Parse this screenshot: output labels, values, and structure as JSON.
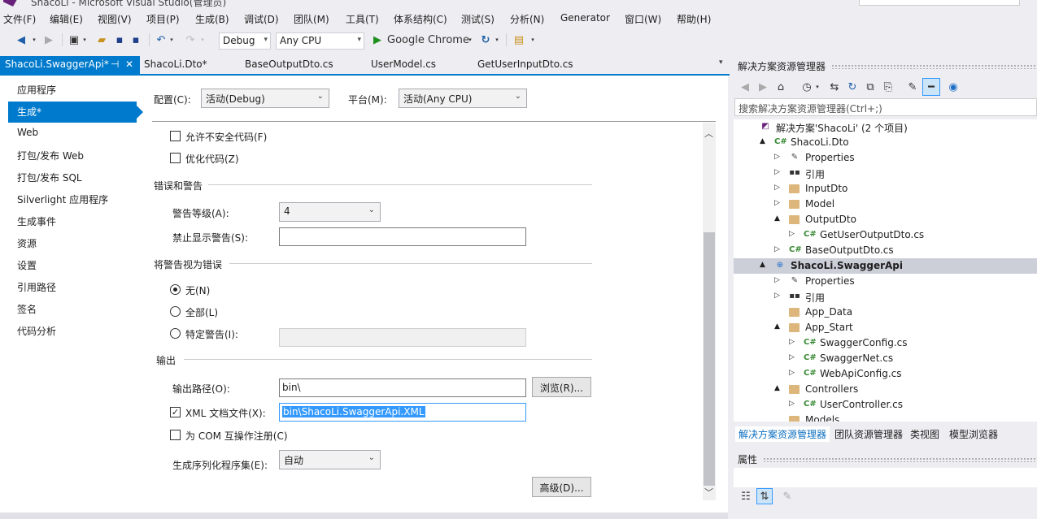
{
  "window": {
    "title": "ShacoLi - Microsoft Visual Studio(管理员)"
  },
  "menu": [
    "文件(F)",
    "编辑(E)",
    "视图(V)",
    "项目(P)",
    "生成(B)",
    "调试(D)",
    "团队(M)",
    "工具(T)",
    "体系结构(C)",
    "测试(S)",
    "分析(N)",
    "Generator",
    "窗口(W)",
    "帮助(H)"
  ],
  "toolbar": {
    "config": "Debug",
    "platform": "Any CPU",
    "run_target": "Google Chrome"
  },
  "tabs": [
    {
      "label": "ShacoLi.SwaggerApi*",
      "pin": "⊣",
      "close": "✕"
    },
    {
      "label": "ShacoLi.Dto*"
    },
    {
      "label": "BaseOutputDto.cs"
    },
    {
      "label": "UserModel.cs"
    },
    {
      "label": "GetUserInputDto.cs"
    }
  ],
  "nav": [
    "应用程序",
    "生成*",
    "Web",
    "打包/发布 Web",
    "打包/发布 SQL",
    "Silverlight 应用程序",
    "生成事件",
    "资源",
    "设置",
    "引用路径",
    "签名",
    "代码分析"
  ],
  "top": {
    "config_label": "配置(C):",
    "config_value": "活动(Debug)",
    "platform_label": "平台(M):",
    "platform_value": "活动(Any CPU)"
  },
  "opts": {
    "unsafe_label": "允许不安全代码(F)",
    "optimize_label": "优化代码(Z)"
  },
  "errors": {
    "section": "错误和警告",
    "warn_level_label": "警告等级(A):",
    "warn_level_value": "4",
    "suppress_label": "禁止显示警告(S):",
    "suppress_value": ""
  },
  "treat": {
    "section": "将警告视为错误",
    "none_label": "无(N)",
    "all_label": "全部(L)",
    "specific_label": "特定警告(I):",
    "selected": "none"
  },
  "output": {
    "section": "输出",
    "path_label": "输出路径(O):",
    "path_value": "bin\\",
    "browse_label": "浏览(R)...",
    "xml_label": "XML 文档文件(X):",
    "xml_checked": true,
    "xml_value": "bin\\ShacoLi.SwaggerApi.XML",
    "com_label": "为 COM 互操作注册(C)",
    "serial_label": "生成序列化程序集(E):",
    "serial_value": "自动",
    "advanced_label": "高级(D)..."
  },
  "scroll": {
    "up": "︿",
    "down": "﹀"
  },
  "solution_explorer": {
    "title": "解决方案资源管理器",
    "search_placeholder": "搜索解决方案资源管理器(Ctrl+;)",
    "tree": [
      {
        "label": "解决方案'ShacoLi' (2 个项目)",
        "icon": "solution-icon",
        "level": 0,
        "exp": ""
      },
      {
        "label": "ShacoLi.Dto",
        "icon": "csharp-project-icon",
        "level": 1,
        "exp": "▲"
      },
      {
        "label": "Properties",
        "icon": "wrench-icon",
        "level": 2,
        "exp": "▷"
      },
      {
        "label": "引用",
        "icon": "reference-icon",
        "level": 2,
        "exp": "▷"
      },
      {
        "label": "InputDto",
        "icon": "folder-icon",
        "level": 2,
        "exp": "▷"
      },
      {
        "label": "Model",
        "icon": "folder-icon",
        "level": 2,
        "exp": "▷"
      },
      {
        "label": "OutputDto",
        "icon": "folder-open-icon",
        "level": 2,
        "exp": "▲"
      },
      {
        "label": "GetUserOutputDto.cs",
        "icon": "csharp-file-icon",
        "level": 3,
        "exp": "▷"
      },
      {
        "label": "BaseOutputDto.cs",
        "icon": "csharp-file-icon",
        "level": 2,
        "exp": "▷"
      },
      {
        "label": "ShacoLi.SwaggerApi",
        "icon": "web-project-icon",
        "level": 1,
        "exp": "▲",
        "selected": true
      },
      {
        "label": "Properties",
        "icon": "wrench-icon",
        "level": 2,
        "exp": "▷"
      },
      {
        "label": "引用",
        "icon": "reference-icon",
        "level": 2,
        "exp": "▷"
      },
      {
        "label": "App_Data",
        "icon": "folder-icon",
        "level": 2,
        "exp": ""
      },
      {
        "label": "App_Start",
        "icon": "folder-open-icon",
        "level": 2,
        "exp": "▲"
      },
      {
        "label": "SwaggerConfig.cs",
        "icon": "csharp-file-icon",
        "level": 3,
        "exp": "▷"
      },
      {
        "label": "SwaggerNet.cs",
        "icon": "csharp-file-icon",
        "level": 3,
        "exp": "▷"
      },
      {
        "label": "WebApiConfig.cs",
        "icon": "csharp-file-icon",
        "level": 3,
        "exp": "▷"
      },
      {
        "label": "Controllers",
        "icon": "folder-open-icon",
        "level": 2,
        "exp": "▲"
      },
      {
        "label": "UserController.cs",
        "icon": "csharp-file-icon",
        "level": 3,
        "exp": "▷"
      },
      {
        "label": "Models",
        "icon": "folder-icon",
        "level": 2,
        "exp": ""
      }
    ],
    "bottom_tabs": [
      "解决方案资源管理器",
      "团队资源管理器",
      "类视图",
      "模型浏览器"
    ]
  },
  "properties": {
    "title": "属性"
  }
}
